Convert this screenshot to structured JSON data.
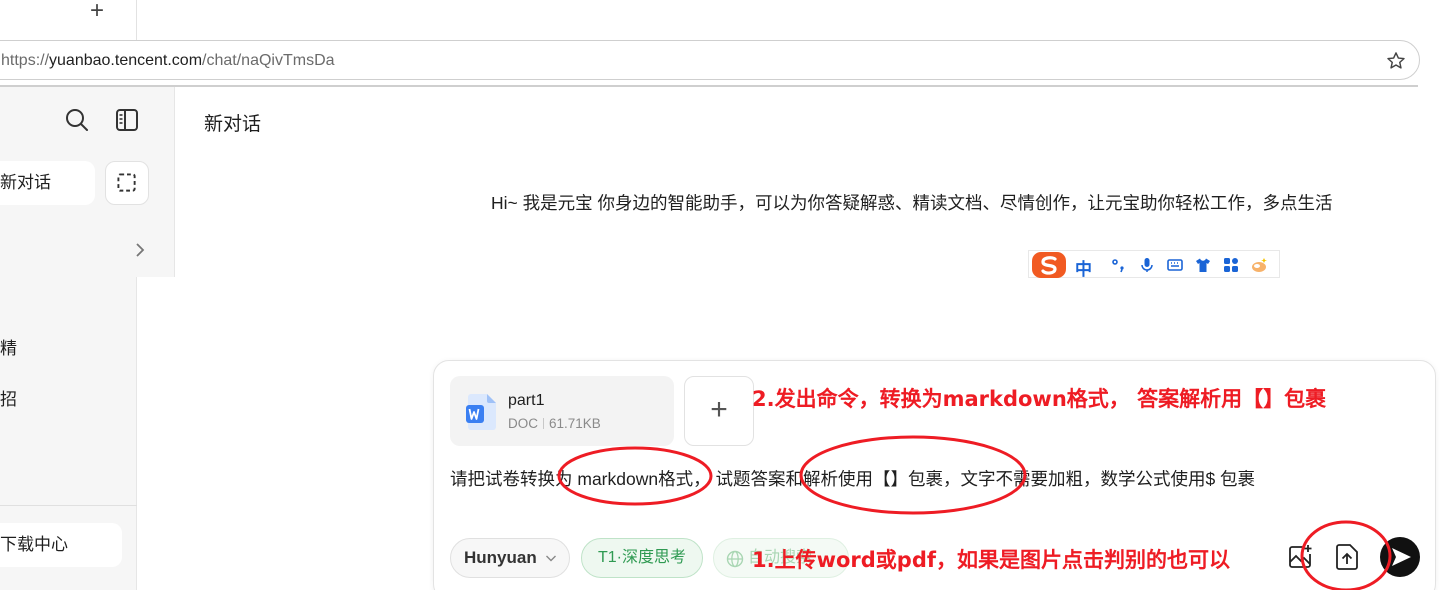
{
  "browser": {
    "new_tab_symbol": "+",
    "url_scheme": "https://",
    "url_host": "yuanbao.tencent.com",
    "url_path": "/chat/naQivTmsDa"
  },
  "sidebar": {
    "new_chat_label": "新对话",
    "items": [
      {
        "label": "精"
      },
      {
        "label": "招"
      }
    ],
    "bottom_label": "下载中心"
  },
  "main": {
    "title": "新对话",
    "greeting": "Hi~ 我是元宝 你身边的智能助手，可以为你答疑解惑、精读文档、尽情创作，让元宝助你轻松工作，多点生活"
  },
  "ime": {
    "mode_label": "中",
    "punct_label": "°,"
  },
  "composer": {
    "file": {
      "name": "part1",
      "type": "DOC",
      "size": "61.71KB"
    },
    "add_file_symbol": "+",
    "prompt_text": "请把试卷转换为 markdown格式， 试题答案和解析使用【】包裹，文字不需要加粗，数学公式使用$ 包裹",
    "model_label": "Hunyuan",
    "think_label": "T1·深度思考",
    "search_label": "自动搜索"
  },
  "annotations": {
    "step1": "1.上传word或pdf，如果是图片点击判别的也可以",
    "step2": "2.发出命令，转换为markdown格式， 答案解析用【】包裹"
  },
  "colors": {
    "annotation_red": "#ee1c24",
    "think_green": "#2f9a52",
    "word_blue": "#3a7ff2",
    "ime_blue": "#1a64d6"
  }
}
